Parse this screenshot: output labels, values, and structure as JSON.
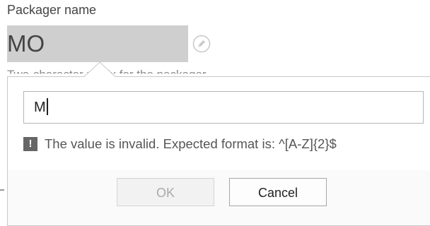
{
  "field": {
    "label": "Packager name",
    "value": "MO",
    "edit_icon": "pencil-edit-icon"
  },
  "behind_text": "Two-character prefix for the packager",
  "popup": {
    "input_value": "M",
    "error_icon": "exclamation-icon",
    "error_text": "The value is invalid. Expected format is: ^[A-Z]{2}$",
    "ok_label": "OK",
    "cancel_label": "Cancel"
  }
}
